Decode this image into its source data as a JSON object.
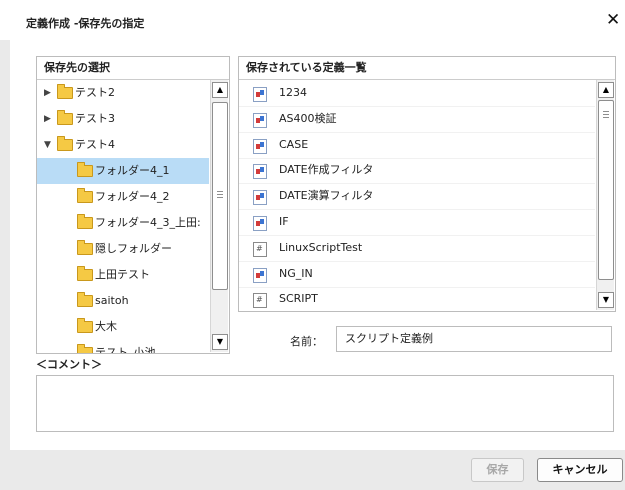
{
  "dialog": {
    "title": "定義作成 -保存先の指定",
    "close": "✕"
  },
  "left_panel": {
    "header": "保存先の選択",
    "items": [
      {
        "label": "テスト2",
        "expander": "▶"
      },
      {
        "label": "テスト3",
        "expander": "▶"
      },
      {
        "label": "テスト4",
        "expander": "▼"
      },
      {
        "label": "フォルダー4_1",
        "expander": ""
      },
      {
        "label": "フォルダー4_2",
        "expander": ""
      },
      {
        "label": "フォルダー4_3_上田:",
        "expander": ""
      },
      {
        "label": "隠しフォルダー",
        "expander": ""
      },
      {
        "label": "上田テスト",
        "expander": ""
      },
      {
        "label": "saitoh",
        "expander": ""
      },
      {
        "label": "大木",
        "expander": ""
      },
      {
        "label": "テスト_小池",
        "expander": ""
      }
    ],
    "selected_index": 3
  },
  "right_panel": {
    "header": "保存されている定義一覧",
    "items": [
      {
        "label": "1234",
        "icon": "definition-icon"
      },
      {
        "label": "AS400検証",
        "icon": "definition-icon"
      },
      {
        "label": "CASE",
        "icon": "definition-icon"
      },
      {
        "label": "DATE作成フィルタ",
        "icon": "definition-icon"
      },
      {
        "label": "DATE演算フィルタ",
        "icon": "definition-icon"
      },
      {
        "label": "IF",
        "icon": "definition-icon"
      },
      {
        "label": "LinuxScriptTest",
        "icon": "script-icon"
      },
      {
        "label": "NG_IN",
        "icon": "definition-icon"
      },
      {
        "label": "SCRIPT",
        "icon": "script-icon"
      }
    ]
  },
  "name_field": {
    "label": "名前：",
    "value": "スクリプト定義例"
  },
  "comment": {
    "label": "＜コメント＞",
    "value": ""
  },
  "buttons": {
    "save": "保存",
    "cancel": "キャンセル"
  },
  "scroll": {
    "up": "▲",
    "down": "▼"
  }
}
